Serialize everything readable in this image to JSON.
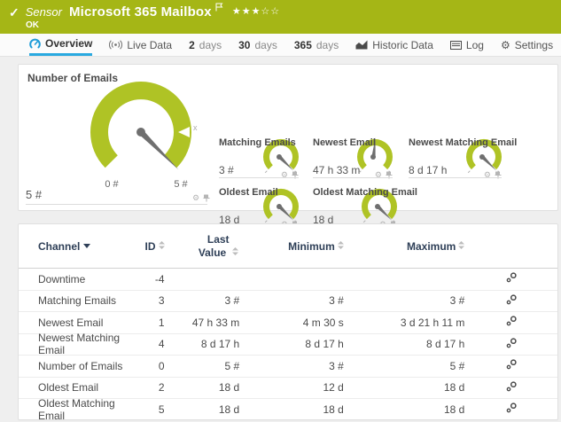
{
  "header": {
    "check_icon": "✓",
    "kind_label": "Sensor",
    "title": "Microsoft 365 Mailbox",
    "status": "OK",
    "rating_stars": "★★★☆☆",
    "bar_color": "#a5b616"
  },
  "tabs": [
    {
      "label": "Overview",
      "icon": "gauge-icon",
      "active": true
    },
    {
      "label": "Live Data",
      "icon": "broadcast-icon"
    },
    {
      "num": "2",
      "label": "days"
    },
    {
      "num": "30",
      "label": "days"
    },
    {
      "num": "365",
      "label": "days"
    },
    {
      "label": "Historic Data",
      "icon": "chart-icon"
    },
    {
      "label": "Log",
      "icon": "log-icon"
    },
    {
      "label": "Settings",
      "icon": "gear-icon"
    }
  ],
  "gauges": {
    "accent_color": "#afc325",
    "needle_color": "#6f6f6f",
    "primary": {
      "title": "Number of Emails",
      "value": "5 #",
      "scale_min": "0 #",
      "scale_max": "5 #",
      "marker_label": "x",
      "needle_fraction": 1.0
    },
    "mini": [
      {
        "title": "Matching Emails",
        "value": "3 #",
        "needle_fraction": 1.0
      },
      {
        "title": "Newest Email",
        "value": "47 h 33 m",
        "needle_fraction": 0.52
      },
      {
        "title": "Newest Matching Email",
        "value": "8 d 17 h",
        "needle_fraction": 1.0
      },
      {
        "title": "Oldest Email",
        "value": "18 d",
        "needle_fraction": 1.0
      },
      {
        "title": "Oldest Matching Email",
        "value": "18 d",
        "needle_fraction": 1.0
      }
    ]
  },
  "table": {
    "columns": {
      "channel": "Channel",
      "id": "ID",
      "last_value": "Last Value",
      "minimum": "Minimum",
      "maximum": "Maximum"
    },
    "sorted_by": "Channel",
    "rows": [
      {
        "channel": "Downtime",
        "id": "-4",
        "last": "",
        "min": "",
        "max": ""
      },
      {
        "channel": "Matching Emails",
        "id": "3",
        "last": "3 #",
        "min": "3 #",
        "max": "3 #"
      },
      {
        "channel": "Newest Email",
        "id": "1",
        "last": "47 h 33 m",
        "min": "4 m 30 s",
        "max": "3 d 21 h 11 m"
      },
      {
        "channel": "Newest Matching Email",
        "id": "4",
        "last": "8 d 17 h",
        "min": "8 d 17 h",
        "max": "8 d 17 h"
      },
      {
        "channel": "Number of Emails",
        "id": "0",
        "last": "5 #",
        "min": "3 #",
        "max": "5 #"
      },
      {
        "channel": "Oldest Email",
        "id": "2",
        "last": "18 d",
        "min": "12 d",
        "max": "18 d"
      },
      {
        "channel": "Oldest Matching Email",
        "id": "5",
        "last": "18 d",
        "min": "18 d",
        "max": "18 d"
      }
    ]
  }
}
